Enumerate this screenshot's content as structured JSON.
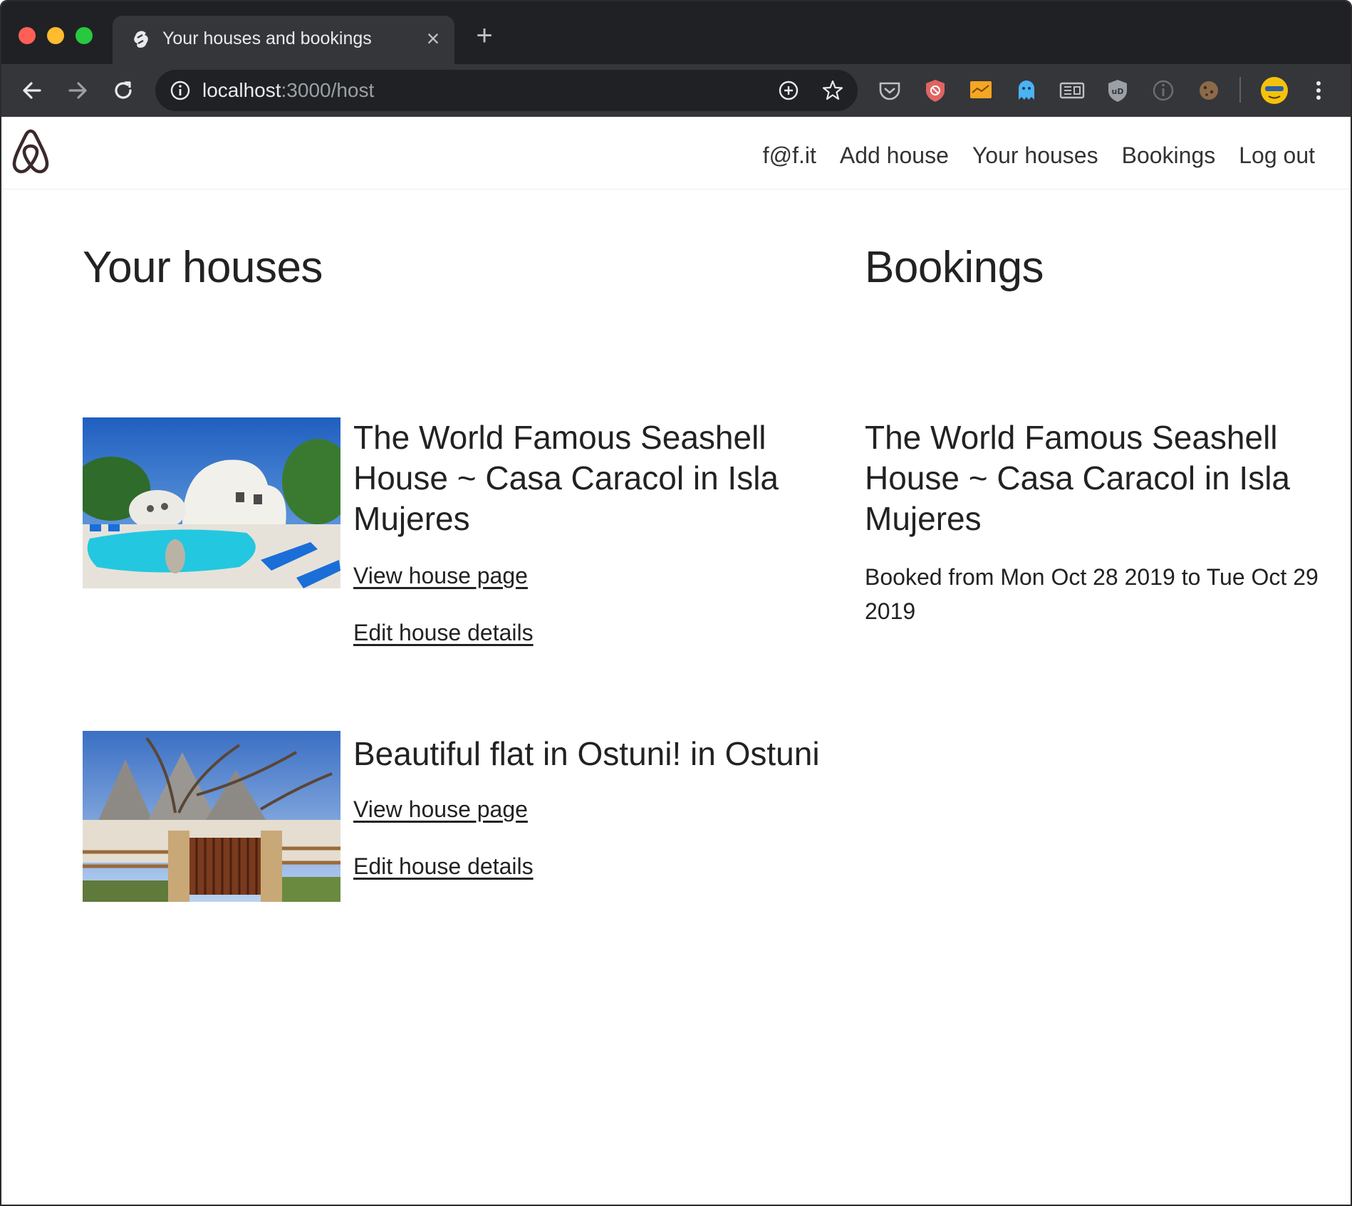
{
  "browser": {
    "tab_title": "Your houses and bookings",
    "tab_close": "×",
    "new_tab": "+",
    "url_host": "localhost",
    "url_rest": ":3000/host"
  },
  "site": {
    "nav": [
      "f@f.it",
      "Add house",
      "Your houses",
      "Bookings",
      "Log out"
    ]
  },
  "houses_section": {
    "title": "Your houses",
    "houses": [
      {
        "title": "The World Famous Seashell House ~ Casa Caracol in Isla Mujeres",
        "view_link": "View house page",
        "edit_link": "Edit house details"
      },
      {
        "title": "Beautiful flat in Ostuni! in Ostuni",
        "view_link": "View house page",
        "edit_link": "Edit house details"
      }
    ]
  },
  "bookings_section": {
    "title": "Bookings",
    "bookings": [
      {
        "house": "The World Famous Seashell House ~ Casa Caracol in Isla Mujeres",
        "text": "Booked from Mon Oct 28 2019 to Tue Oct 29 2019"
      }
    ]
  },
  "colors": {
    "chrome_dark": "#202124",
    "chrome_mid": "#35363a",
    "logo": "#3b2a2a"
  }
}
